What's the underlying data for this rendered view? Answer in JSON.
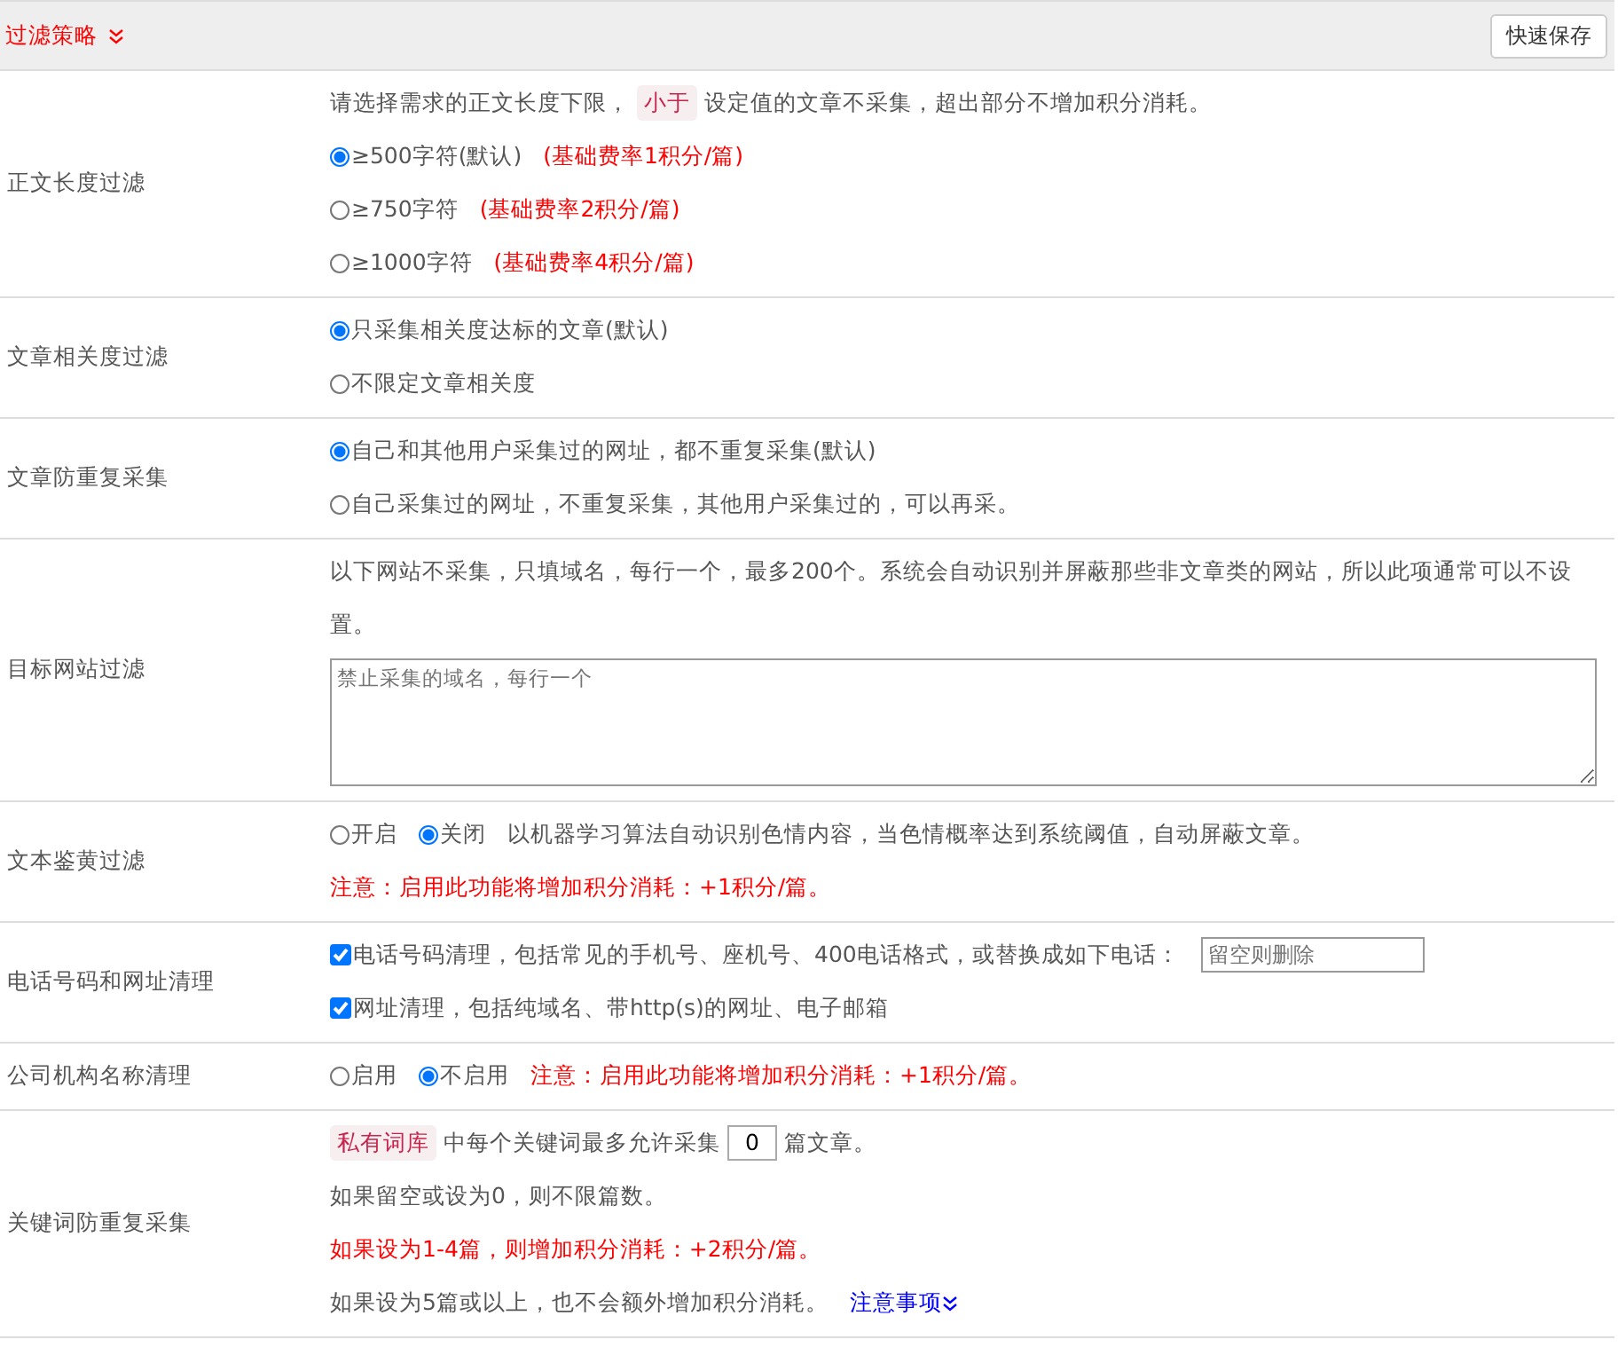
{
  "header": {
    "title": "过滤策略",
    "button": "快速保存"
  },
  "rows": [
    {
      "label": "正文长度过滤",
      "lines": [
        [
          {
            "kind": "text",
            "text": "请选择需求的正文长度下限，"
          },
          {
            "kind": "tag",
            "text": "小于"
          },
          {
            "kind": "text",
            "text": "设定值的文章不采集，超出部分不增加积分消耗。"
          }
        ],
        [
          {
            "kind": "radio",
            "text": "≥500字符(默认)",
            "selected": true
          },
          {
            "kind": "note",
            "text": "(基础费率1积分/篇)"
          }
        ],
        [
          {
            "kind": "radio",
            "text": "≥750字符",
            "selected": false
          },
          {
            "kind": "note",
            "text": "(基础费率2积分/篇)"
          }
        ],
        [
          {
            "kind": "radio",
            "text": "≥1000字符",
            "selected": false
          },
          {
            "kind": "note",
            "text": "(基础费率4积分/篇)"
          }
        ]
      ]
    },
    {
      "label": "文章相关度过滤",
      "lines": [
        [
          {
            "kind": "radio",
            "text": "只采集相关度达标的文章(默认)",
            "selected": true
          }
        ],
        [
          {
            "kind": "radio",
            "text": "不限定文章相关度",
            "selected": false
          }
        ]
      ]
    },
    {
      "label": "文章防重复采集",
      "lines": [
        [
          {
            "kind": "radio",
            "text": "自己和其他用户采集过的网址，都不重复采集(默认)",
            "selected": true
          }
        ],
        [
          {
            "kind": "radio",
            "text": "自己采集过的网址，不重复采集，其他用户采集过的，可以再采。",
            "selected": false
          }
        ]
      ]
    },
    {
      "label": "目标网站过滤",
      "lines": [
        [
          {
            "kind": "text",
            "text": "以下网站不采集，只填域名，每行一个，最多200个。系统会自动识别并屏蔽那些非文章类的网站，所以此项通常可以不设置。"
          }
        ],
        [
          {
            "kind": "textarea",
            "placeholder": "禁止采集的域名，每行一个"
          }
        ]
      ]
    },
    {
      "label": "文本鉴黄过滤",
      "lines": [
        [
          {
            "kind": "radio",
            "text": "开启",
            "selected": false
          },
          {
            "kind": "radio",
            "text": "关闭",
            "selected": true
          },
          {
            "kind": "text",
            "text": "以机器学习算法自动识别色情内容，当色情概率达到系统阈值，自动屏蔽文章。"
          }
        ],
        [
          {
            "kind": "note",
            "text": "注意：启用此功能将增加积分消耗：+1积分/篇。"
          }
        ]
      ]
    },
    {
      "label": "电话号码和网址清理",
      "lines": [
        [
          {
            "kind": "checkbox",
            "text": "电话号码清理，包括常见的手机号、座机号、400电话格式，或替换成如下电话：",
            "checked": true
          },
          {
            "kind": "input",
            "placeholder": "留空则删除"
          }
        ],
        [
          {
            "kind": "checkbox",
            "text": "网址清理，包括纯域名、带http(s)的网址、电子邮箱",
            "checked": true
          }
        ]
      ]
    },
    {
      "label": "公司机构名称清理",
      "lines": [
        [
          {
            "kind": "radio",
            "text": "启用",
            "selected": false
          },
          {
            "kind": "radio",
            "text": "不启用",
            "selected": true
          },
          {
            "kind": "note",
            "text": "注意：启用此功能将增加积分消耗：+1积分/篇。"
          }
        ]
      ]
    },
    {
      "label": "关键词防重复采集",
      "lines": [
        [
          {
            "kind": "tag",
            "text": "私有词库"
          },
          {
            "kind": "text",
            "text": "中每个关键词最多允许采集"
          },
          {
            "kind": "number",
            "value": "0"
          },
          {
            "kind": "text",
            "text": "篇文章。"
          }
        ],
        [
          {
            "kind": "text",
            "text": "如果留空或设为0，则不限篇数。"
          }
        ],
        [
          {
            "kind": "note",
            "text": "如果设为1-4篇，则增加积分消耗：+2积分/篇。"
          }
        ],
        [
          {
            "kind": "text",
            "text": "如果设为5篇或以上，也不会额外增加积分消耗。"
          },
          {
            "kind": "link",
            "text": "注意事项"
          }
        ]
      ]
    }
  ]
}
